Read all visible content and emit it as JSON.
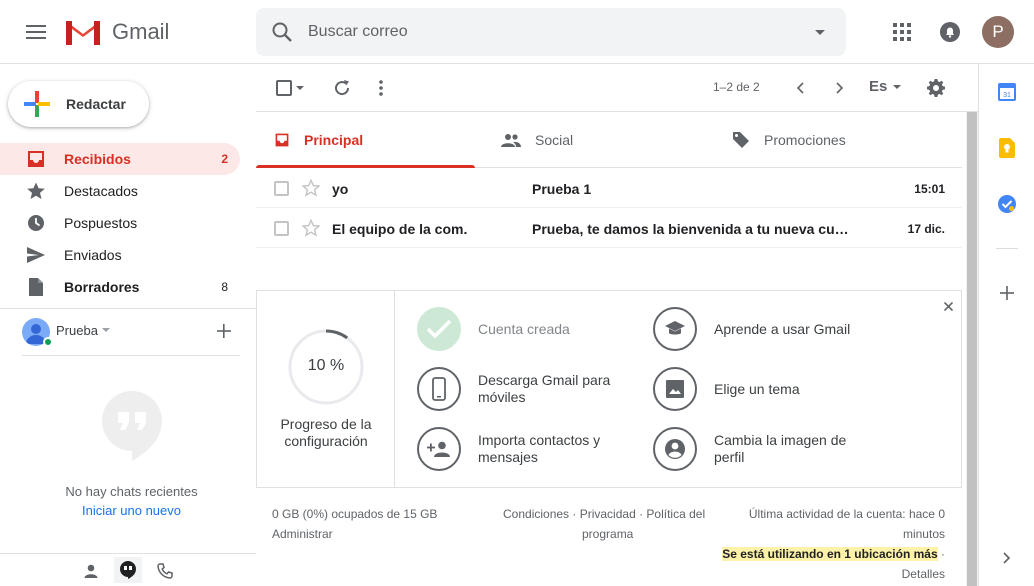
{
  "header": {
    "logo_text": "Gmail",
    "search_placeholder": "Buscar correo",
    "avatar_letter": "P"
  },
  "compose": {
    "label": "Redactar"
  },
  "nav": {
    "items": [
      {
        "label": "Recibidos",
        "count": "2",
        "icon": "inbox-icon",
        "active": true
      },
      {
        "label": "Destacados",
        "count": "",
        "icon": "star-icon"
      },
      {
        "label": "Pospuestos",
        "count": "",
        "icon": "clock-icon"
      },
      {
        "label": "Enviados",
        "count": "",
        "icon": "send-icon"
      },
      {
        "label": "Borradores",
        "count": "8",
        "icon": "draft-icon",
        "bold": true
      }
    ]
  },
  "hangouts": {
    "user_name": "Prueba",
    "no_chats": "No hay chats recientes",
    "start_new": "Iniciar uno nuevo"
  },
  "toolbar": {
    "page_info": "1–2 de 2",
    "language": "Es"
  },
  "tabs": [
    {
      "label": "Principal",
      "icon": "inbox-icon"
    },
    {
      "label": "Social",
      "icon": "people-icon"
    },
    {
      "label": "Promociones",
      "icon": "tag-icon"
    }
  ],
  "mails": [
    {
      "sender": "yo",
      "subject": "Prueba 1",
      "date": "15:01"
    },
    {
      "sender": "El equipo de la com.",
      "subject": "Prueba, te damos la bienvenida a tu nueva cuenta",
      "date": "17 dic."
    }
  ],
  "setup": {
    "progress_percent": 10,
    "progress_text": "10 %",
    "progress_label": "Progreso de la configuración",
    "items": [
      {
        "label": "Cuenta creada",
        "icon": "check-icon",
        "done": true
      },
      {
        "label": "Aprende a usar Gmail",
        "icon": "school-icon"
      },
      {
        "label": "Descarga Gmail para móviles",
        "icon": "phone-icon"
      },
      {
        "label": "Elige un tema",
        "icon": "image-icon"
      },
      {
        "label": "Importa contactos y mensajes",
        "icon": "add-person-icon"
      },
      {
        "label": "Cambia la imagen de perfil",
        "icon": "account-icon"
      }
    ]
  },
  "footer": {
    "storage": "0 GB (0%) ocupados de 15 GB",
    "manage": "Administrar",
    "terms": "Condiciones",
    "privacy": "Privacidad",
    "policy_line1": "Política del",
    "policy_line2": "programa",
    "activity_line1": "Última actividad de la cuenta: hace 0",
    "activity_line2": "minutos",
    "locations": "Se está utilizando en 1 ubicación más",
    "details": "Detalles"
  },
  "colors": {
    "accent_red": "#d93025",
    "active_bg": "#fce8e6",
    "avatar_bg": "#8d6e63"
  }
}
